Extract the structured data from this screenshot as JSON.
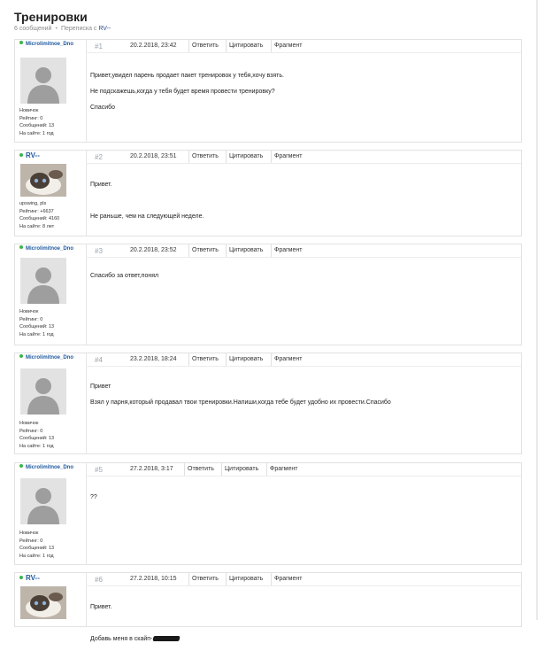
{
  "page": {
    "title": "Тренировки",
    "message_count": "6 сообщений",
    "conversation_prefix": "Переписка с",
    "conversation_user": "RV--"
  },
  "buttons": {
    "reply": "Ответить",
    "quote": "Цитировать",
    "fragment": "Фрагмент"
  },
  "posts": [
    {
      "num": "#1",
      "date": "20.2.2018, 23:42",
      "user": {
        "name": "Microlimitnoe_Dno",
        "online": true,
        "avatar": "default-avatar",
        "rank": "Новичок",
        "rating": "Рейтинг: 0",
        "messages": "Сообщений: 13",
        "onsite": "На сайте: 1 год"
      },
      "lines": [
        "Привет,увидел парень продает пакет тренировок у тебя,хочу взять.",
        "Не подскажешь,когда у тебя будет время провести тренировку?",
        "Спасибо"
      ]
    },
    {
      "num": "#2",
      "date": "20.2.2018, 23:51",
      "user": {
        "name": "RV--",
        "online": true,
        "avatar": "cat-avatar",
        "rank": "upswing, pls",
        "rating": "Рейтинг: +6637",
        "messages": "Сообщений: 4160",
        "onsite": "На сайте: 8 лет"
      },
      "lines": [
        "Привет.",
        "",
        "Не раньше, чем на следующей неделе."
      ]
    },
    {
      "num": "#3",
      "date": "20.2.2018, 23:52",
      "user": {
        "name": "Microlimitnoe_Dno",
        "online": true,
        "avatar": "default-avatar",
        "rank": "Новичок",
        "rating": "Рейтинг: 0",
        "messages": "Сообщений: 13",
        "onsite": "На сайте: 1 год"
      },
      "lines": [
        "Спасибо за ответ,понял"
      ]
    },
    {
      "num": "#4",
      "date": "23.2.2018, 18:24",
      "user": {
        "name": "Microlimitnoe_Dno",
        "online": true,
        "avatar": "default-avatar",
        "rank": "Новичок",
        "rating": "Рейтинг: 0",
        "messages": "Сообщений: 13",
        "onsite": "На сайте: 1 год"
      },
      "lines": [
        "Привет",
        "Взял у парня,который продавал твои тренировки.Напиши,когда тебе будет удобно их провести.Спасибо"
      ]
    },
    {
      "num": "#5",
      "date": "27.2.2018, 3:17",
      "user": {
        "name": "Microlimitnoe_Dno",
        "online": true,
        "avatar": "default-avatar",
        "rank": "Новичок",
        "rating": "Рейтинг: 0",
        "messages": "Сообщений: 13",
        "onsite": "На сайте: 1 год"
      },
      "lines": [
        "??"
      ]
    },
    {
      "num": "#6",
      "date": "27.2.2018, 10:15",
      "user": {
        "name": "RV--",
        "online": true,
        "avatar": "cat-avatar",
        "rank": "",
        "rating": "",
        "messages": "",
        "onsite": ""
      },
      "lines": [
        "Привет.",
        "",
        "Добавь меня в скайп-"
      ]
    }
  ],
  "colors": {
    "username": "#1f5aa0",
    "online": "#3cb54a",
    "post_number": "#9aa3ad",
    "border": "#e2e2e2"
  }
}
